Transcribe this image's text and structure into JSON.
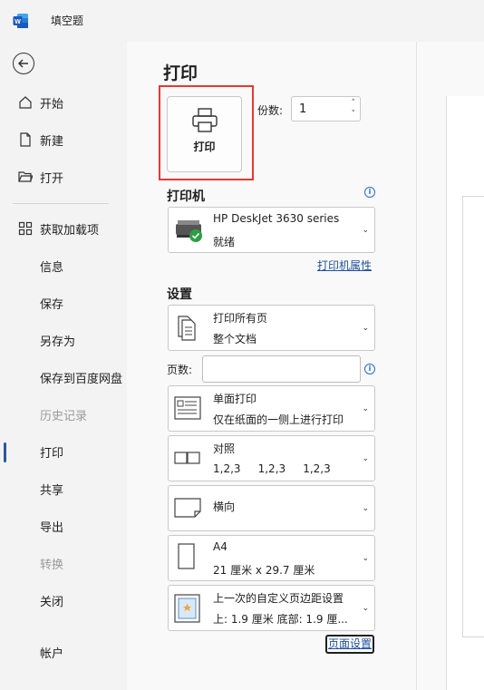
{
  "titlebar": {
    "app_icon": "word-icon",
    "doc_title": "填空题"
  },
  "sidebar": {
    "back_icon": "back-arrow-icon",
    "top_items": [
      {
        "label": "开始",
        "icon": "home-icon"
      },
      {
        "label": "新建",
        "icon": "new-doc-icon"
      },
      {
        "label": "打开",
        "icon": "open-folder-icon"
      }
    ],
    "addins": {
      "label": "获取加载项",
      "icon": "addins-icon"
    },
    "items": [
      {
        "label": "信息"
      },
      {
        "label": "保存"
      },
      {
        "label": "另存为"
      },
      {
        "label": "保存到百度网盘"
      },
      {
        "label": "历史记录",
        "disabled": true
      },
      {
        "label": "打印",
        "active": true
      },
      {
        "label": "共享"
      },
      {
        "label": "导出"
      },
      {
        "label": "转换",
        "disabled": true
      },
      {
        "label": "关闭"
      }
    ],
    "account": "帐户"
  },
  "main": {
    "title": "打印",
    "print_button": "打印",
    "copies_label": "份数:",
    "copies_value": "1",
    "printer_heading": "打印机",
    "printer": {
      "name": "HP DeskJet 3630 series",
      "status": "就绪"
    },
    "printer_props_link": "打印机属性",
    "settings_heading": "设置",
    "print_range": {
      "line1": "打印所有页",
      "line2": "整个文档"
    },
    "pages_label": "页数:",
    "pages_value": "",
    "sides": {
      "line1": "单面打印",
      "line2": "仅在纸面的一侧上进行打印"
    },
    "collate": {
      "line1": "对照",
      "line2": "1,2,3     1,2,3     1,2,3"
    },
    "orientation": {
      "line1": "横向"
    },
    "paper": {
      "line1": "A4",
      "line2": "21 厘米 x 29.7 厘米"
    },
    "margins": {
      "line1": "上一次的自定义页边距设置",
      "line2": "上: 1.9 厘米 底部: 1.9 厘..."
    },
    "page_setup_link": "页面设置"
  },
  "colors": {
    "accent": "#2b579a",
    "highlight": "#e53935",
    "link": "#1f4e9c",
    "ready": "#2e9e44"
  }
}
